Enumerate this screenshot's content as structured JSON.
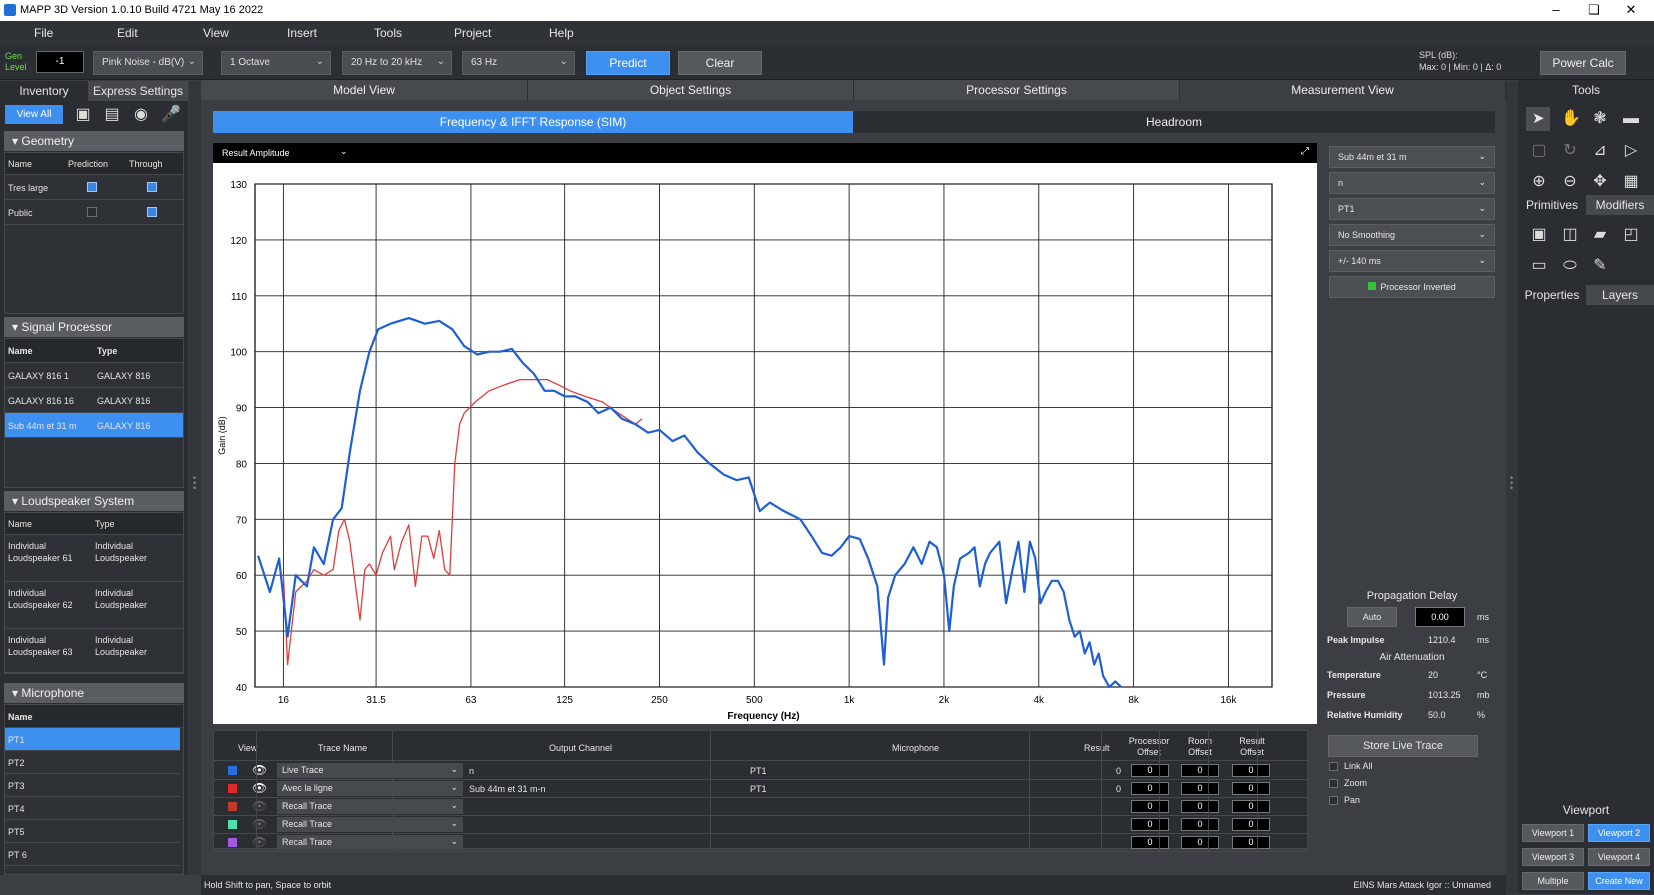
{
  "window": {
    "title": "MAPP 3D Version 1.0.10 Build 4721 May 16 2022"
  },
  "menu": [
    "File",
    "Edit",
    "View",
    "Insert",
    "Tools",
    "Project",
    "Help"
  ],
  "toolbar": {
    "gen_level_label": "Gen Level",
    "gen_level_value": "-1",
    "signal": "Pink Noise - dB(V)",
    "bandwidth": "1 Octave",
    "range": "20 Hz to 20 kHz",
    "freq": "63 Hz",
    "predict": "Predict",
    "clear": "Clear",
    "spl_label": "SPL (dB):",
    "spl_values": "Max: 0 | Min: 0 | Δ: 0",
    "power_calc": "Power Calc"
  },
  "left_tabs": {
    "inventory": "Inventory",
    "express": "Express Settings",
    "view_all": "View All"
  },
  "geometry": {
    "title": "Geometry",
    "cols": [
      "Name",
      "Prediction",
      "Through"
    ],
    "rows": [
      {
        "name": "Tres large",
        "prediction": true,
        "through": true
      },
      {
        "name": "Public",
        "prediction": false,
        "through": true
      }
    ]
  },
  "signal_processor": {
    "title": "Signal Processor",
    "cols": [
      "Name",
      "Type"
    ],
    "rows": [
      {
        "name": "GALAXY 816 1",
        "type": "GALAXY 816"
      },
      {
        "name": "GALAXY 816 16",
        "type": "GALAXY 816"
      },
      {
        "name": "Sub 44m et 31 m",
        "type": "GALAXY 816"
      }
    ]
  },
  "loudspeaker": {
    "title": "Loudspeaker System",
    "cols": [
      "Name",
      "Type"
    ],
    "rows": [
      {
        "name1": "Individual",
        "name2": "Loudspeaker 61",
        "type1": "Individual",
        "type2": "Loudspeaker"
      },
      {
        "name1": "Individual",
        "name2": "Loudspeaker 62",
        "type1": "Individual",
        "type2": "Loudspeaker"
      },
      {
        "name1": "Individual",
        "name2": "Loudspeaker 63",
        "type1": "Individual",
        "type2": "Loudspeaker"
      }
    ]
  },
  "microphone": {
    "title": "Microphone",
    "col": "Name",
    "rows": [
      "PT1",
      "PT2",
      "PT3",
      "PT4",
      "PT5",
      "PT 6"
    ]
  },
  "main_tabs": [
    "Model View",
    "Object Settings",
    "Processor Settings",
    "Measurement View"
  ],
  "sub_tabs": [
    "Frequency & IFFT Response (SIM)",
    "Headroom"
  ],
  "plot_header": "Result Amplitude",
  "right_dropdowns": [
    "Sub 44m et 31 m",
    "n",
    "PT1",
    "No Smoothing",
    "+/- 140 ms"
  ],
  "processor_inverted": "Processor Inverted",
  "propagation": {
    "title": "Propagation Delay",
    "auto": "Auto",
    "value": "0.00",
    "unit": "ms",
    "peak_label": "Peak Impulse",
    "peak_value": "1210.4",
    "peak_unit": "ms",
    "air_title": "Air Attenuation",
    "temp_label": "Temperature",
    "temp_value": "20",
    "temp_unit": "°C",
    "pressure_label": "Pressure",
    "pressure_value": "1013.25",
    "pressure_unit": "mb",
    "humidity_label": "Relative Humidity",
    "humidity_value": "50.0",
    "humidity_unit": "%"
  },
  "trace_table": {
    "headers": [
      "View",
      "Trace Name",
      "Output Channel",
      "Microphone",
      "Result",
      "Processor Offset",
      "Room Offset",
      "Result Offset"
    ],
    "rows": [
      {
        "color": "#2a6fe0",
        "name": "Live Trace",
        "output": "n",
        "mic": "PT1",
        "result": "0",
        "po": "0",
        "ro": "0",
        "rso": "0"
      },
      {
        "color": "#e02a2a",
        "name": "Avec la ligne",
        "output": "Sub 44m et 31 m-n",
        "mic": "PT1",
        "result": "0",
        "po": "0",
        "ro": "0",
        "rso": "0"
      },
      {
        "color": "#c0392b",
        "name": "Recall Trace",
        "output": "",
        "mic": "",
        "result": "",
        "po": "0",
        "ro": "0",
        "rso": "0"
      },
      {
        "color": "#4fe0b0",
        "name": "Recall Trace",
        "output": "",
        "mic": "",
        "result": "",
        "po": "0",
        "ro": "0",
        "rso": "0"
      },
      {
        "color": "#a35be0",
        "name": "Recall Trace",
        "output": "",
        "mic": "",
        "result": "",
        "po": "0",
        "ro": "0",
        "rso": "0"
      }
    ]
  },
  "store": {
    "button": "Store Live Trace",
    "link_all": "Link All",
    "zoom": "Zoom",
    "pan": "Pan"
  },
  "tools": {
    "title": "Tools",
    "primitives": "Primitives",
    "modifiers": "Modifiers",
    "properties": "Properties",
    "layers": "Layers"
  },
  "viewport": {
    "title": "Viewport",
    "buttons": [
      "Viewport 1",
      "Viewport 2",
      "Viewport 3",
      "Viewport 4",
      "Multiple",
      "Create New"
    ]
  },
  "status": {
    "left": "Hold Shift to pan, Space to orbit",
    "right": "EINS Mars Attack Igor :: Unnamed"
  },
  "colors": {
    "accent": "#3d8ff0",
    "live": "#1f5fd6",
    "recall": "#e23b3b"
  },
  "chart_data": {
    "type": "line",
    "xscale": "log",
    "xlabel": "Frequency (Hz)",
    "ylabel": "Gain (dB)",
    "xlim": [
      13,
      22000
    ],
    "ylim": [
      40,
      130
    ],
    "xticks": [
      "16",
      "31.5",
      "63",
      "125",
      "250",
      "500",
      "1k",
      "2k",
      "4k",
      "8k",
      "16k"
    ],
    "xtick_values": [
      16,
      31.5,
      63,
      125,
      250,
      500,
      1000,
      2000,
      4000,
      8000,
      16000
    ],
    "yticks": [
      130,
      120,
      110,
      100,
      90,
      80,
      70,
      60,
      50,
      40
    ],
    "series": [
      {
        "name": "Live Trace",
        "color": "#1f5fd6",
        "points": [
          [
            13.3,
            63.5
          ],
          [
            14.5,
            57
          ],
          [
            15.5,
            63
          ],
          [
            16.5,
            49
          ],
          [
            17.5,
            60
          ],
          [
            19,
            58
          ],
          [
            20,
            65
          ],
          [
            21.5,
            62
          ],
          [
            23,
            70
          ],
          [
            24.5,
            72
          ],
          [
            26,
            82
          ],
          [
            28,
            93
          ],
          [
            30,
            100
          ],
          [
            32,
            104
          ],
          [
            35,
            105
          ],
          [
            40,
            106
          ],
          [
            45,
            105
          ],
          [
            50,
            105.5
          ],
          [
            55,
            104
          ],
          [
            60,
            101
          ],
          [
            66,
            99.5
          ],
          [
            72,
            100
          ],
          [
            78,
            100
          ],
          [
            85,
            100.5
          ],
          [
            92,
            98
          ],
          [
            100,
            96
          ],
          [
            108,
            93
          ],
          [
            116,
            93
          ],
          [
            125,
            92
          ],
          [
            135,
            92
          ],
          [
            148,
            91
          ],
          [
            160,
            89
          ],
          [
            175,
            90
          ],
          [
            190,
            88
          ],
          [
            210,
            87
          ],
          [
            230,
            85.5
          ],
          [
            250,
            86
          ],
          [
            275,
            84
          ],
          [
            300,
            85
          ],
          [
            330,
            82
          ],
          [
            360,
            80
          ],
          [
            400,
            78
          ],
          [
            440,
            77
          ],
          [
            480,
            77.5
          ],
          [
            520,
            71.5
          ],
          [
            560,
            73
          ],
          [
            620,
            71.5
          ],
          [
            700,
            70
          ],
          [
            760,
            67
          ],
          [
            820,
            64
          ],
          [
            880,
            63.5
          ],
          [
            940,
            65
          ],
          [
            1000,
            67
          ],
          [
            1080,
            66.5
          ],
          [
            1150,
            63
          ],
          [
            1230,
            58
          ],
          [
            1290,
            44
          ],
          [
            1330,
            56
          ],
          [
            1400,
            60
          ],
          [
            1500,
            62
          ],
          [
            1600,
            65
          ],
          [
            1700,
            62
          ],
          [
            1800,
            66
          ],
          [
            1900,
            65
          ],
          [
            2000,
            60
          ],
          [
            2080,
            50
          ],
          [
            2150,
            58
          ],
          [
            2250,
            63
          ],
          [
            2400,
            64
          ],
          [
            2500,
            65
          ],
          [
            2600,
            58
          ],
          [
            2700,
            62
          ],
          [
            2800,
            64
          ],
          [
            3000,
            66
          ],
          [
            3150,
            55
          ],
          [
            3300,
            61
          ],
          [
            3450,
            66
          ],
          [
            3600,
            57
          ],
          [
            3750,
            66
          ],
          [
            3900,
            63
          ],
          [
            4050,
            55
          ],
          [
            4200,
            57
          ],
          [
            4400,
            59
          ],
          [
            4600,
            59
          ],
          [
            4800,
            57
          ],
          [
            5000,
            52
          ],
          [
            5200,
            49
          ],
          [
            5400,
            50
          ],
          [
            5600,
            46
          ],
          [
            5800,
            48
          ],
          [
            6000,
            44
          ],
          [
            6200,
            46
          ],
          [
            6400,
            42
          ],
          [
            6700,
            40
          ],
          [
            7000,
            41
          ],
          [
            7300,
            40
          ]
        ]
      },
      {
        "name": "Avec la ligne",
        "color": "#e23b3b",
        "points": [
          [
            16,
            60
          ],
          [
            16.5,
            44
          ],
          [
            17.5,
            57
          ],
          [
            19,
            59
          ],
          [
            20,
            61
          ],
          [
            21.5,
            60
          ],
          [
            23,
            61
          ],
          [
            24,
            68
          ],
          [
            25,
            70
          ],
          [
            26,
            66
          ],
          [
            28,
            52
          ],
          [
            29,
            61
          ],
          [
            30,
            62
          ],
          [
            31.5,
            60
          ],
          [
            33,
            64
          ],
          [
            35,
            67
          ],
          [
            36,
            61
          ],
          [
            38,
            66
          ],
          [
            40,
            69
          ],
          [
            42,
            58
          ],
          [
            44,
            67
          ],
          [
            46,
            67
          ],
          [
            48,
            63
          ],
          [
            50,
            68
          ],
          [
            52,
            61
          ],
          [
            54,
            60
          ],
          [
            56,
            80
          ],
          [
            58,
            87
          ],
          [
            60,
            89
          ],
          [
            65,
            91
          ],
          [
            72,
            93
          ],
          [
            80,
            94
          ],
          [
            90,
            95
          ],
          [
            100,
            95
          ],
          [
            110,
            95
          ],
          [
            120,
            94
          ],
          [
            130,
            93
          ],
          [
            145,
            92
          ],
          [
            165,
            91
          ],
          [
            185,
            89
          ],
          [
            210,
            87
          ],
          [
            220,
            88
          ]
        ]
      }
    ]
  }
}
